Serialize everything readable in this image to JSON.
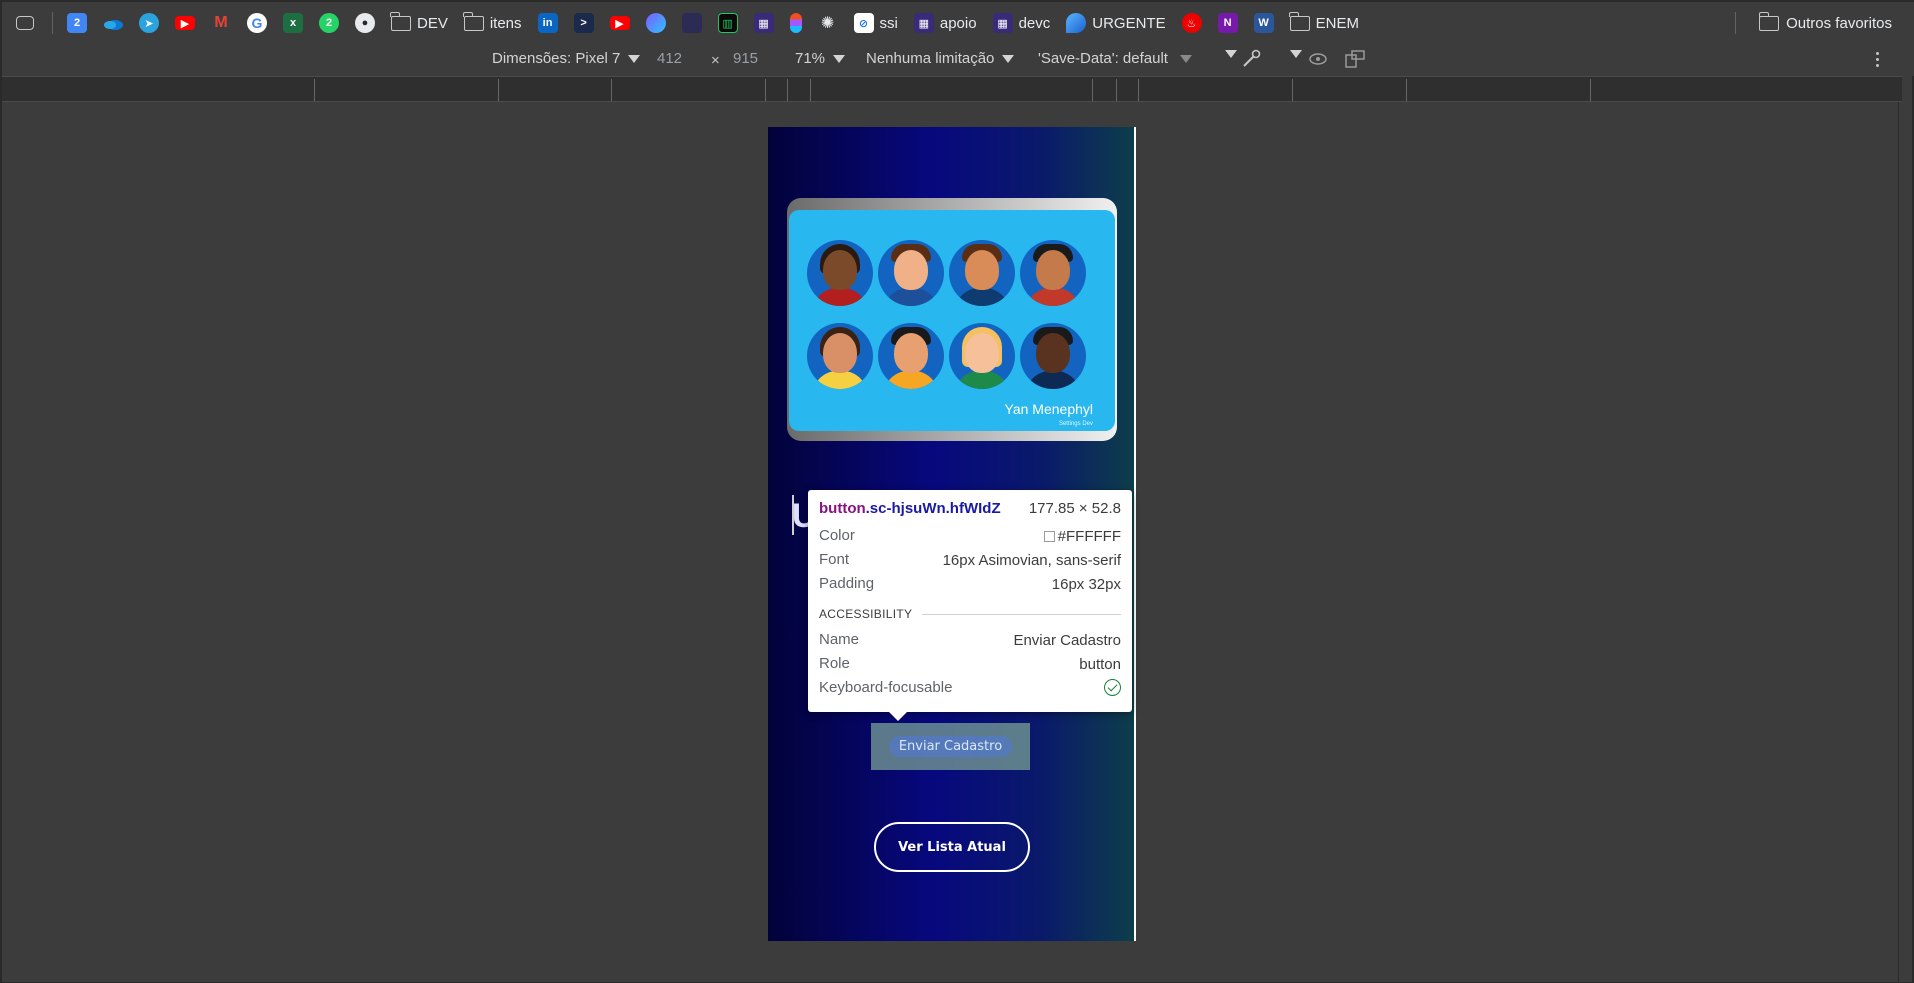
{
  "bookmarks": {
    "items": [
      {
        "icon": "tab-search-icon",
        "label": ""
      },
      {
        "icon": "calendar-icon",
        "label": "",
        "badge": "2"
      },
      {
        "icon": "onedrive-icon",
        "label": ""
      },
      {
        "icon": "telegram-icon",
        "label": ""
      },
      {
        "icon": "youtube-icon",
        "label": ""
      },
      {
        "icon": "gmail-icon",
        "label": ""
      },
      {
        "icon": "google-icon",
        "label": ""
      },
      {
        "icon": "excel-icon",
        "label": ""
      },
      {
        "icon": "whatsapp-icon",
        "label": ""
      },
      {
        "icon": "github-icon",
        "label": ""
      },
      {
        "icon": "folder-icon",
        "label": "DEV"
      },
      {
        "icon": "folder-icon",
        "label": "itens"
      },
      {
        "icon": "linkedin-icon",
        "label": ""
      },
      {
        "icon": "prompt-icon",
        "label": ""
      },
      {
        "icon": "youtube-icon",
        "label": ""
      },
      {
        "icon": "app-icon",
        "label": ""
      },
      {
        "icon": "avatar-icon",
        "label": ""
      },
      {
        "icon": "chart-icon",
        "label": ""
      },
      {
        "icon": "grid-icon",
        "label": ""
      },
      {
        "icon": "figma-icon",
        "label": ""
      },
      {
        "icon": "openai-icon",
        "label": ""
      },
      {
        "icon": "compass-icon",
        "label": "ssi"
      },
      {
        "icon": "grid-icon",
        "label": "apoio"
      },
      {
        "icon": "grid-icon",
        "label": "devc"
      },
      {
        "icon": "drop-icon",
        "label": "URGENTE"
      },
      {
        "icon": "santander-icon",
        "label": ""
      },
      {
        "icon": "onenote-icon",
        "label": ""
      },
      {
        "icon": "word-icon",
        "label": ""
      },
      {
        "icon": "folder-icon",
        "label": "ENEM"
      }
    ],
    "other_favorites": "Outros favoritos"
  },
  "device_toolbar": {
    "dimensions_label": "Dimensões: Pixel 7",
    "width": "412",
    "times": "×",
    "height": "915",
    "zoom": "71%",
    "throttling": "Nenhuma limitação",
    "save_data": "'Save-Data': default"
  },
  "page": {
    "card_name": "Yan Menephyl",
    "card_sub": "Settings Dev",
    "partial_heading": "U",
    "send_button": "Enviar Cadastro",
    "list_button": "Ver Lista Atual"
  },
  "tooltip": {
    "tag": "button",
    "class": ".sc-hjsuWn.hfWIdZ",
    "size": "177.85 × 52.8",
    "rows": [
      {
        "key": "Color",
        "value": "#FFFFFF"
      },
      {
        "key": "Font",
        "value": "16px Asimovian, sans-serif"
      },
      {
        "key": "Padding",
        "value": "16px 32px"
      }
    ],
    "section": "ACCESSIBILITY",
    "a11y": [
      {
        "key": "Name",
        "value": "Enviar Cadastro"
      },
      {
        "key": "Role",
        "value": "button"
      },
      {
        "key": "Keyboard-focusable",
        "value": ""
      }
    ]
  },
  "colors": {
    "accent_blue": "#07087e",
    "card_bg": "#28b7ee",
    "tooltip_tag": "#881280",
    "tooltip_class": "#1a1aa6",
    "check_green": "#188038"
  }
}
